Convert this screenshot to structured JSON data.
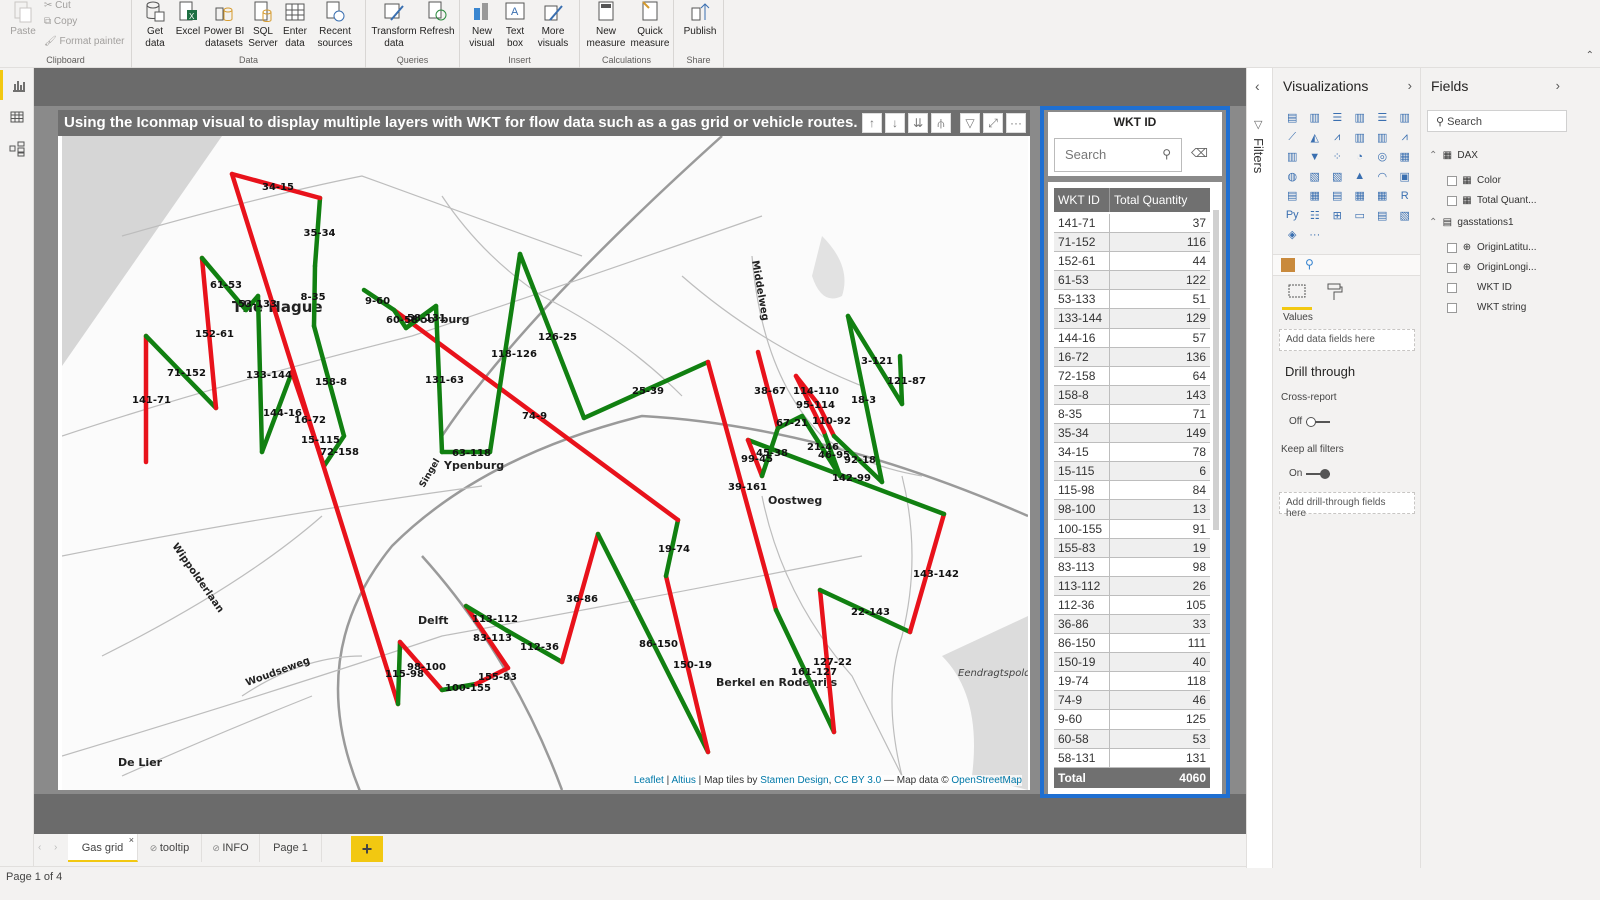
{
  "ribbon": {
    "clipboard": {
      "label": "Clipboard",
      "paste": "Paste",
      "cut": "Cut",
      "copy": "Copy",
      "format_painter": "Format painter"
    },
    "data": {
      "label": "Data",
      "buttons": [
        "Get data",
        "Excel",
        "Power BI datasets",
        "SQL Server",
        "Enter data",
        "Recent sources"
      ]
    },
    "queries": {
      "label": "Queries",
      "buttons": [
        "Transform data",
        "Refresh"
      ]
    },
    "insert": {
      "label": "Insert",
      "buttons": [
        "New visual",
        "Text box",
        "More visuals"
      ]
    },
    "calculations": {
      "label": "Calculations",
      "buttons": [
        "New measure",
        "Quick measure"
      ]
    },
    "share": {
      "label": "Share",
      "buttons": [
        "Publish"
      ]
    }
  },
  "leftrail": {
    "items": [
      "report-view",
      "data-view",
      "model-view"
    ]
  },
  "map": {
    "title": "Using the Iconmap visual to display multiple layers with WKT for flow data such as a gas grid or vehicle routes.",
    "header_icons": [
      "arrow-up",
      "arrow-down",
      "double-arrow-down",
      "expand-hierarchy",
      "filter",
      "focus-mode",
      "more-options"
    ],
    "attribution": {
      "leaflet": "Leaflet",
      "altius": "Altius",
      "tiles_text": "Map tiles by",
      "stamen": "Stamen Design",
      "cc": "CC BY 3.0",
      "data_text": "— Map data ©",
      "osm": "OpenStreetMap"
    },
    "places": [
      "The Hague",
      "Voorburg",
      "Ypenburg",
      "Delft",
      "Berkel en Rodenrijs",
      "Oostweg",
      "Middelweg",
      "Wippolderlaan",
      "Woudseweg",
      "De Lier",
      "Eendragtspolder",
      "Singel"
    ],
    "segment_colors": {
      "positive": "#118011",
      "negative": "#e8121b"
    },
    "segments": [
      {
        "id": "141-71",
        "color": "negative"
      },
      {
        "id": "71-152",
        "color": "positive"
      },
      {
        "id": "152-61",
        "color": "negative"
      },
      {
        "id": "61-53",
        "color": "positive"
      },
      {
        "id": "53-133",
        "color": "positive"
      },
      {
        "id": "133-144",
        "color": "positive"
      },
      {
        "id": "144-16",
        "color": "positive"
      },
      {
        "id": "16-72",
        "color": "negative"
      },
      {
        "id": "72-158",
        "color": "positive"
      },
      {
        "id": "158-8",
        "color": "positive"
      },
      {
        "id": "8-35",
        "color": "positive"
      },
      {
        "id": "35-34",
        "color": "positive"
      },
      {
        "id": "34-15",
        "color": "negative"
      },
      {
        "id": "15-115",
        "color": "negative"
      },
      {
        "id": "115-98",
        "color": "positive"
      },
      {
        "id": "98-100",
        "color": "negative"
      },
      {
        "id": "100-155",
        "color": "positive"
      },
      {
        "id": "155-83",
        "color": "negative"
      },
      {
        "id": "83-113",
        "color": "negative"
      },
      {
        "id": "113-112",
        "color": "positive"
      },
      {
        "id": "112-36",
        "color": "positive"
      },
      {
        "id": "36-86",
        "color": "negative"
      },
      {
        "id": "86-150",
        "color": "positive"
      },
      {
        "id": "150-19",
        "color": "negative"
      },
      {
        "id": "19-74",
        "color": "positive"
      },
      {
        "id": "74-9",
        "color": "negative"
      },
      {
        "id": "9-60",
        "color": "positive"
      },
      {
        "id": "60-58",
        "color": "positive"
      },
      {
        "id": "58-131",
        "color": "positive"
      },
      {
        "id": "131-63",
        "color": "positive"
      },
      {
        "id": "63-118",
        "color": "positive"
      },
      {
        "id": "118-126",
        "color": "positive"
      },
      {
        "id": "126-25",
        "color": "positive"
      },
      {
        "id": "25-39",
        "color": "positive"
      },
      {
        "id": "39-161",
        "color": "negative"
      },
      {
        "id": "161-127",
        "color": "positive"
      },
      {
        "id": "127-22",
        "color": "negative"
      },
      {
        "id": "22-143",
        "color": "positive"
      },
      {
        "id": "143-142",
        "color": "negative"
      },
      {
        "id": "142-99",
        "color": "positive"
      },
      {
        "id": "99-45",
        "color": "negative"
      },
      {
        "id": "45-38",
        "color": "positive"
      },
      {
        "id": "38-67",
        "color": "negative"
      },
      {
        "id": "67-21",
        "color": "positive"
      },
      {
        "id": "21-46",
        "color": "positive"
      },
      {
        "id": "46-95",
        "color": "positive"
      },
      {
        "id": "95-114",
        "color": "negative"
      },
      {
        "id": "114-110",
        "color": "negative"
      },
      {
        "id": "110-92",
        "color": "negative"
      },
      {
        "id": "92-18",
        "color": "positive"
      },
      {
        "id": "18-3",
        "color": "positive"
      },
      {
        "id": "3-121",
        "color": "positive"
      },
      {
        "id": "121-87",
        "color": "positive"
      }
    ]
  },
  "slicer": {
    "title": "WKT ID",
    "search_placeholder": "Search"
  },
  "table": {
    "columns": [
      "WKT ID",
      "Total Quantity"
    ],
    "rows": [
      [
        "141-71",
        "37"
      ],
      [
        "71-152",
        "116"
      ],
      [
        "152-61",
        "44"
      ],
      [
        "61-53",
        "122"
      ],
      [
        "53-133",
        "51"
      ],
      [
        "133-144",
        "129"
      ],
      [
        "144-16",
        "57"
      ],
      [
        "16-72",
        "136"
      ],
      [
        "72-158",
        "64"
      ],
      [
        "158-8",
        "143"
      ],
      [
        "8-35",
        "71"
      ],
      [
        "35-34",
        "149"
      ],
      [
        "34-15",
        "78"
      ],
      [
        "15-115",
        "6"
      ],
      [
        "115-98",
        "84"
      ],
      [
        "98-100",
        "13"
      ],
      [
        "100-155",
        "91"
      ],
      [
        "155-83",
        "19"
      ],
      [
        "83-113",
        "98"
      ],
      [
        "113-112",
        "26"
      ],
      [
        "112-36",
        "105"
      ],
      [
        "36-86",
        "33"
      ],
      [
        "86-150",
        "111"
      ],
      [
        "150-19",
        "40"
      ],
      [
        "19-74",
        "118"
      ],
      [
        "74-9",
        "46"
      ],
      [
        "9-60",
        "125"
      ],
      [
        "60-58",
        "53"
      ],
      [
        "58-131",
        "131"
      ]
    ],
    "total_label": "Total",
    "total_value": "4060"
  },
  "page_tabs": {
    "tabs": [
      "Gas grid",
      "tooltip",
      "INFO",
      "Page 1"
    ],
    "active": "Gas grid",
    "add": "+"
  },
  "status": {
    "page": "Page 1 of 4"
  },
  "filters": {
    "label": "Filters"
  },
  "visualizations": {
    "title": "Visualizations",
    "values_label": "Values",
    "values_placeholder": "Add data fields here",
    "drill_through": "Drill through",
    "cross_report": "Cross-report",
    "cross_report_state": "Off",
    "keep_filters": "Keep all filters",
    "keep_filters_state": "On",
    "drill_placeholder": "Add drill-through fields here",
    "more": "···"
  },
  "fields": {
    "title": "Fields",
    "search_placeholder": "Search",
    "tables": [
      {
        "name": "DAX",
        "items": [
          "Color",
          "Total Quant..."
        ]
      },
      {
        "name": "gasstations1",
        "items": [
          "OriginLatitu...",
          "OriginLongi...",
          "WKT ID",
          "WKT string"
        ]
      }
    ]
  }
}
